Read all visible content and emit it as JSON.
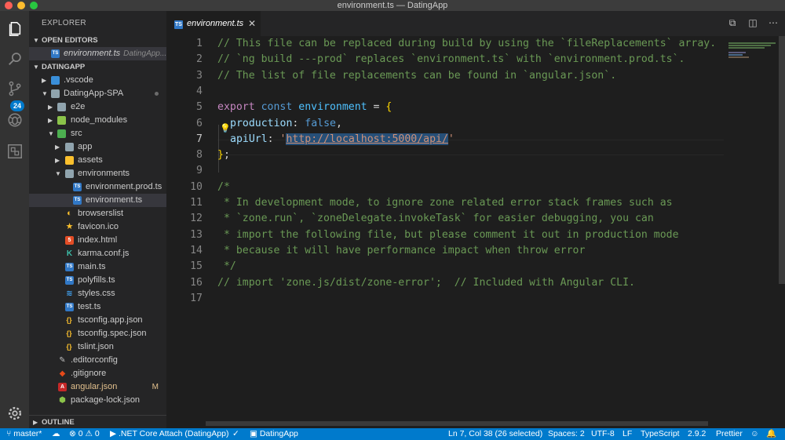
{
  "window": {
    "title": "environment.ts — DatingApp"
  },
  "activity": {
    "scm_badge": "24"
  },
  "explorer": {
    "title": "EXPLORER",
    "open_editors": {
      "label": "OPEN EDITORS",
      "items": [
        {
          "name": "environment.ts",
          "path": "DatingApp..."
        }
      ]
    },
    "workspace": {
      "label": "DATINGAPP"
    },
    "tree": [
      {
        "label": ".vscode"
      },
      {
        "label": "DatingApp-SPA"
      },
      {
        "label": "e2e"
      },
      {
        "label": "node_modules"
      },
      {
        "label": "src"
      },
      {
        "label": "app"
      },
      {
        "label": "assets"
      },
      {
        "label": "environments"
      },
      {
        "label": "environment.prod.ts"
      },
      {
        "label": "environment.ts"
      },
      {
        "label": "browserslist"
      },
      {
        "label": "favicon.ico"
      },
      {
        "label": "index.html"
      },
      {
        "label": "karma.conf.js"
      },
      {
        "label": "main.ts"
      },
      {
        "label": "polyfills.ts"
      },
      {
        "label": "styles.css"
      },
      {
        "label": "test.ts"
      },
      {
        "label": "tsconfig.app.json"
      },
      {
        "label": "tsconfig.spec.json"
      },
      {
        "label": "tslint.json"
      },
      {
        "label": ".editorconfig"
      },
      {
        "label": ".gitignore"
      },
      {
        "label": "angular.json",
        "badge": "M"
      },
      {
        "label": "package-lock.json"
      }
    ],
    "outline": "OUTLINE"
  },
  "editor": {
    "tab": {
      "label": "environment.ts",
      "icon": "TS"
    },
    "line_numbers": [
      "1",
      "2",
      "3",
      "4",
      "5",
      "6",
      "7",
      "8",
      "9",
      "10",
      "11",
      "12",
      "13",
      "14",
      "15",
      "16",
      "17"
    ],
    "code": {
      "l1": "// This file can be replaced during build by using the `fileReplacements` array.",
      "l2": "// `ng build ---prod` replaces `environment.ts` with `environment.prod.ts`.",
      "l3": "// The list of file replacements can be found in `angular.json`.",
      "l5_kw": "export",
      "l5_kw2": "const",
      "l5_var": "environment",
      "l5_eq": " = ",
      "l5_brace": "{",
      "l6_prop": "production",
      "l6_colon": ": ",
      "l6_val": "false",
      "l6_comma": ",",
      "l7_prop": "apiUrl",
      "l7_colon": ": ",
      "l7_q1": "'",
      "l7_url": "http://localhost:5000/api/",
      "l7_q2": "'",
      "l8_brace": "}",
      "l8_semi": ";",
      "l10": "/*",
      "l11": " * In development mode, to ignore zone related error stack frames such as",
      "l12": " * `zone.run`, `zoneDelegate.invokeTask` for easier debugging, you can",
      "l13": " * import the following file, but please comment it out in production mode",
      "l14": " * because it will have performance impact when throw error",
      "l15": " */",
      "l16": "// import 'zone.js/dist/zone-error';  // Included with Angular CLI."
    }
  },
  "status": {
    "branch": "master*",
    "errors": "0",
    "warnings": "0",
    "debug": ".NET Core Attach (DatingApp)",
    "folder": "DatingApp",
    "position": "Ln 7, Col 38 (26 selected)",
    "spaces": "Spaces: 2",
    "encoding": "UTF-8",
    "eol": "LF",
    "language": "TypeScript",
    "version": "2.9.2",
    "formatter": "Prettier"
  },
  "colors": {
    "accent": "#007acc",
    "sidebar": "#252526",
    "editor": "#1e1e1e"
  }
}
